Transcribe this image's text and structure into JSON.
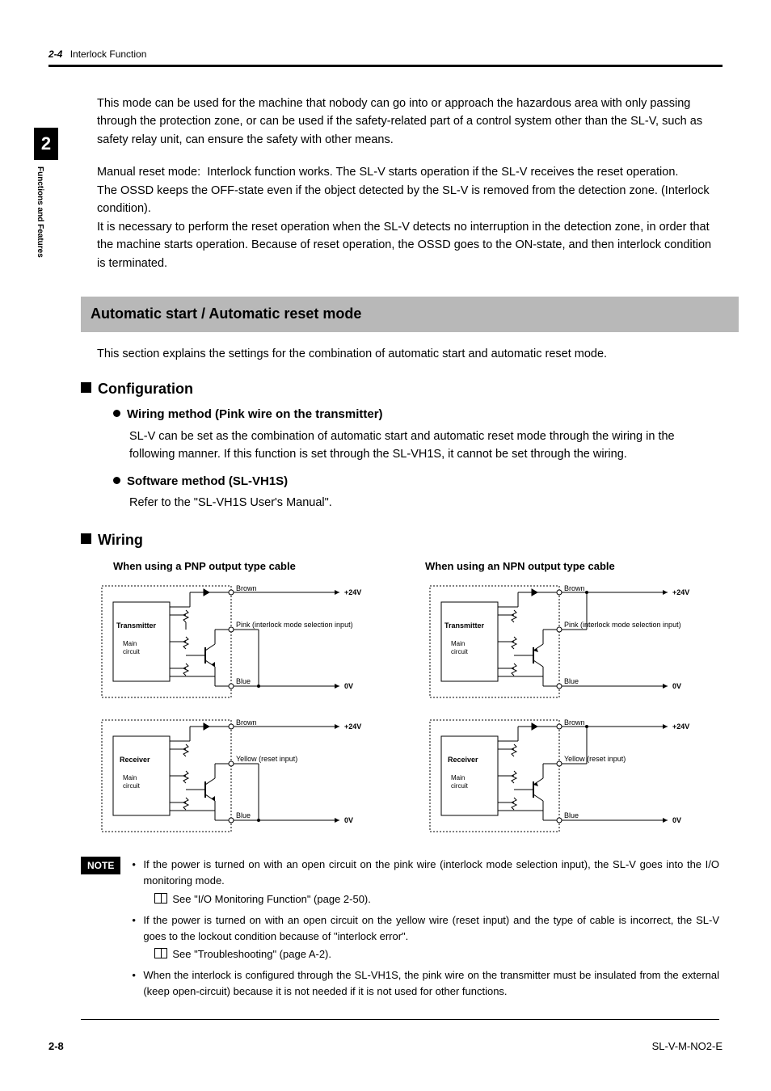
{
  "header": {
    "section_number": "2-4",
    "section_title": "Interlock Function"
  },
  "side_tab": {
    "number": "2",
    "label": "Functions and Features"
  },
  "intro": {
    "p1": "This mode can be used for the machine that nobody can go into or approach the hazardous area with only passing through the protection zone, or can be used if the safety-related part of a control system other than the SL-V, such as safety relay unit, can ensure the safety with other means.",
    "p2a": "Manual reset mode:",
    "p2b": "Interlock function works. The SL-V starts operation if the SL-V receives the reset operation.",
    "p3": "The OSSD keeps the OFF-state even if the object detected by the SL-V is removed from the detection zone. (Interlock condition).",
    "p4": "It is necessary to perform the reset operation when the SL-V detects no interruption in the detection zone, in order that the machine starts operation. Because of reset operation, the OSSD goes to the ON-state, and then interlock condition is terminated."
  },
  "band_title": "Automatic start / Automatic reset mode",
  "band_intro": "This section explains the settings for the combination of automatic start and automatic reset mode.",
  "config": {
    "heading": "Configuration",
    "wm_title": "Wiring method (Pink wire on the transmitter)",
    "wm_text": "SL-V can be set as the combination of automatic start and automatic reset mode through the wiring in the following manner. If this function is set through the SL-VH1S, it cannot be set through the wiring.",
    "sw_title": "Software method (SL-VH1S)",
    "sw_text": "Refer to the \"SL-VH1S User's Manual\"."
  },
  "wiring": {
    "heading": "Wiring",
    "pnp_title": "When using a PNP output type cable",
    "npn_title": "When using an NPN output type cable",
    "labels": {
      "transmitter": "Transmitter",
      "receiver": "Receiver",
      "main_circuit_l1": "Main",
      "main_circuit_l2": "circuit",
      "brown": "Brown",
      "pink": "Pink (interlock mode selection input)",
      "blue": "Blue",
      "yellow": "Yellow (reset input)",
      "v24": "+24V",
      "v0": "0V"
    }
  },
  "note": {
    "tag": "NOTE",
    "n1": "If the power is turned on with an open circuit on the pink wire (interlock mode selection input), the SL-V goes into the I/O monitoring mode.",
    "n1ref": "See \"I/O Monitoring Function\" (page 2-50).",
    "n2": "If the power is turned on with an open circuit on the yellow wire (reset input) and the type of cable is incorrect, the SL-V goes to the lockout condition because of \"interlock error\".",
    "n2ref": "See \"Troubleshooting\" (page A-2).",
    "n3": "When the interlock is configured through the SL-VH1S, the pink wire on the transmitter must be insulated from the external (keep open-circuit) because it is not needed if it is not used for other functions."
  },
  "footer": {
    "page_number": "2-8",
    "doc_code": "SL-V-M-NO2-E"
  }
}
